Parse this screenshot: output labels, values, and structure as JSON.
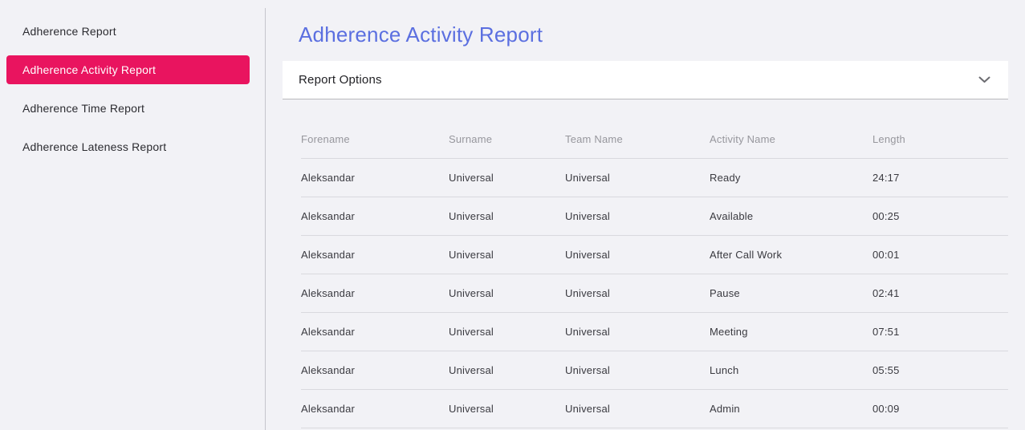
{
  "sidebar": {
    "items": [
      {
        "label": "Adherence Report",
        "active": false
      },
      {
        "label": "Adherence Activity Report",
        "active": true
      },
      {
        "label": "Adherence Time Report",
        "active": false
      },
      {
        "label": "Adherence Lateness Report",
        "active": false
      }
    ]
  },
  "main": {
    "title": "Adherence Activity Report",
    "report_options": {
      "label": "Report Options",
      "state": "collapsed",
      "chevron_icon": "chevron-down-icon"
    }
  },
  "table": {
    "columns": [
      "Forename",
      "Surname",
      "Team Name",
      "Activity Name",
      "Length"
    ],
    "rows": [
      [
        "Aleksandar",
        "Universal",
        "Universal",
        "Ready",
        "24:17"
      ],
      [
        "Aleksandar",
        "Universal",
        "Universal",
        "Available",
        "00:25"
      ],
      [
        "Aleksandar",
        "Universal",
        "Universal",
        "After Call Work",
        "00:01"
      ],
      [
        "Aleksandar",
        "Universal",
        "Universal",
        "Pause",
        "02:41"
      ],
      [
        "Aleksandar",
        "Universal",
        "Universal",
        "Meeting",
        "07:51"
      ],
      [
        "Aleksandar",
        "Universal",
        "Universal",
        "Lunch",
        "05:55"
      ],
      [
        "Aleksandar",
        "Universal",
        "Universal",
        "Admin",
        "00:09"
      ]
    ]
  },
  "colors": {
    "accent_pink": "#e9145f",
    "title_blue": "#5b6fe0",
    "page_bg": "#f2f2f6",
    "separator": "#d9d9de",
    "muted_header": "#97979d"
  }
}
